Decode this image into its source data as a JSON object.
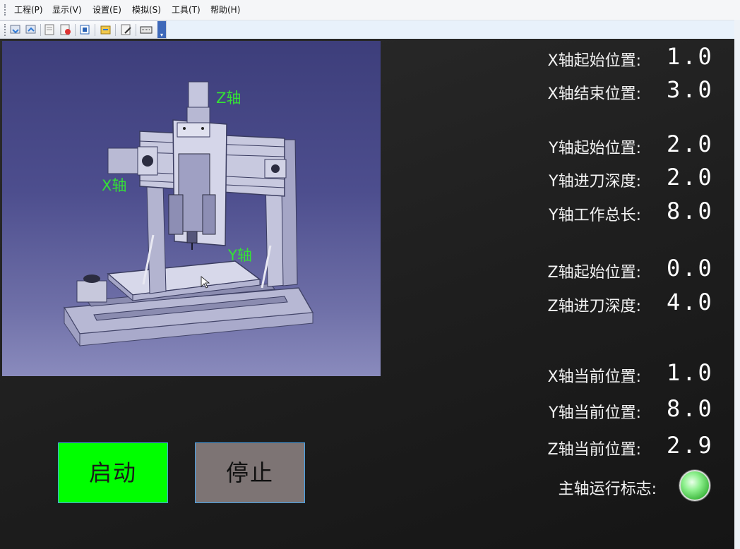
{
  "menu": {
    "items": [
      "工程(P)",
      "显示(V)",
      "设置(E)",
      "模拟(S)",
      "工具(T)",
      "帮助(H)"
    ]
  },
  "toolbar": {
    "icons": [
      "download-icon",
      "upload-icon",
      "project-icon",
      "record-icon",
      "scan-icon",
      "transfer-icon",
      "edit-icon",
      "keyboard-icon"
    ],
    "overflow_glyph": "▾"
  },
  "model_view": {
    "axis_labels": {
      "z": "Z轴",
      "x": "X轴",
      "y": "Y轴"
    }
  },
  "params": {
    "x_start": {
      "label": "X轴起始位置:",
      "value": "1.0"
    },
    "x_end": {
      "label": "X轴结束位置:",
      "value": "3.0"
    },
    "y_start": {
      "label": "Y轴起始位置:",
      "value": "2.0"
    },
    "y_feed": {
      "label": "Y轴进刀深度:",
      "value": "2.0"
    },
    "y_total": {
      "label": "Y轴工作总长:",
      "value": "8.0"
    },
    "z_start": {
      "label": "Z轴起始位置:",
      "value": "0.0"
    },
    "z_feed": {
      "label": "Z轴进刀深度:",
      "value": "4.0"
    },
    "x_current": {
      "label": "X轴当前位置:",
      "value": "1.0"
    },
    "y_current": {
      "label": "Y轴当前位置:",
      "value": "8.0"
    },
    "z_current": {
      "label": "Z轴当前位置:",
      "value": "2.9"
    }
  },
  "controls": {
    "start_label": "启动",
    "stop_label": "停止",
    "start_color": "#00ff00",
    "stop_color": "#7d7474"
  },
  "spindle": {
    "label": "主轴运行标志:",
    "state": "on",
    "indicator_color": "#8ef08e"
  }
}
